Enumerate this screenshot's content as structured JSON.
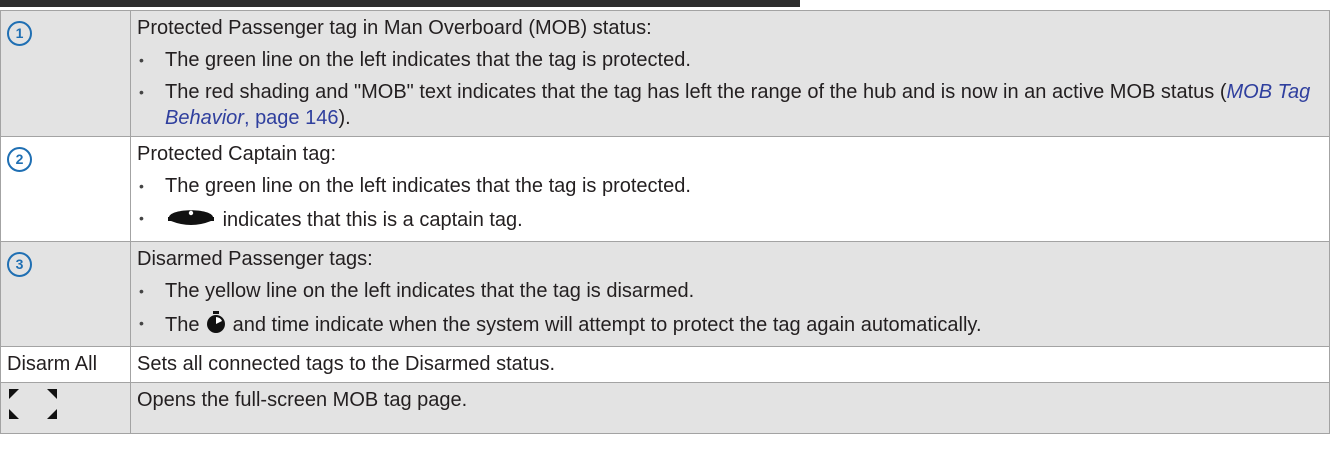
{
  "rows": [
    {
      "callout": "1",
      "intro": "Protected Passenger tag in Man Overboard (MOB) status:",
      "bullets": [
        "The green line on the left indicates that the tag is protected.",
        "The red shading and \"MOB\" text indicates that the tag has left the range of the hub and is now in an active MOB status ("
      ],
      "xref_title": "MOB Tag Behavior",
      "xref_sep": ", ",
      "xref_page": "page 146",
      "xref_close": ")."
    },
    {
      "callout": "2",
      "intro": "Protected Captain tag:",
      "bullets": [
        "The green line on the left indicates that the tag is protected.",
        "indicates that this is a captain tag."
      ],
      "icon": "captain-hat-icon"
    },
    {
      "callout": "3",
      "intro": "Disarmed Passenger tags:",
      "bullets": [
        "The yellow line on the left indicates that the tag is disarmed.",
        "The",
        "and time indicate when the system will attempt to protect the tag again automatically."
      ],
      "icon": "stopwatch-icon"
    },
    {
      "label": "Disarm All",
      "description": "Sets all connected tags to the Disarmed status."
    },
    {
      "icon": "fullscreen-icon",
      "description": "Opens the full-screen MOB tag page."
    }
  ],
  "colors": {
    "callout": "#1f6fb3",
    "link": "#2f3f9e",
    "shade": "#e3e3e3",
    "border": "#a3a3a3"
  }
}
